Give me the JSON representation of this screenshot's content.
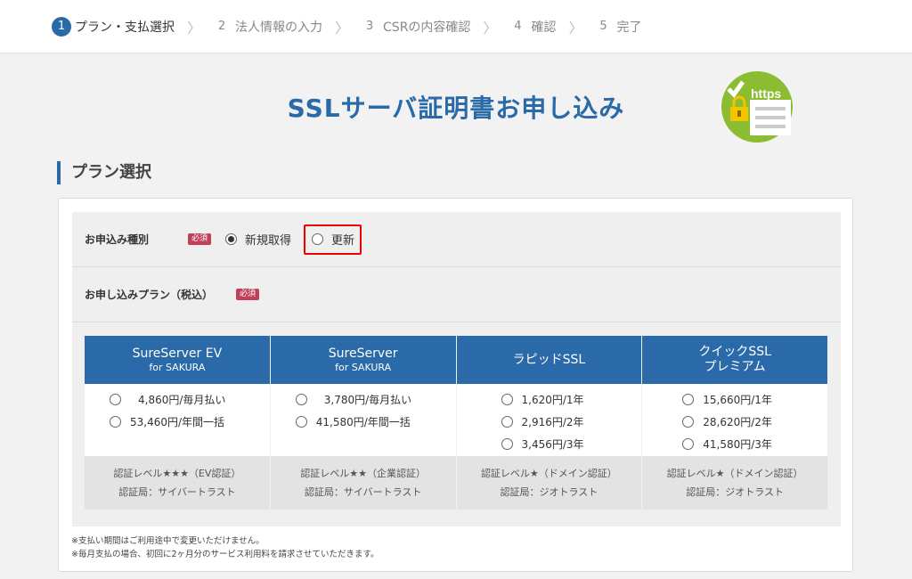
{
  "stepper": {
    "steps": [
      {
        "num": "1",
        "label": "プラン・支払選択"
      },
      {
        "num": "2",
        "label": "法人情報の入力"
      },
      {
        "num": "3",
        "label": "CSRの内容確認"
      },
      {
        "num": "4",
        "label": "確認"
      },
      {
        "num": "5",
        "label": "完了"
      }
    ],
    "active_step": 1
  },
  "page_title": "SSLサーバ証明書お申し込み",
  "badge": {
    "text": "https",
    "icon": "https-lock-icon",
    "color": "#8cbc32"
  },
  "section_title": "プラン選択",
  "form": {
    "required_label": "必須",
    "application_type": {
      "label": "お申込み種別",
      "options": [
        "新規取得",
        "更新"
      ],
      "selected": "新規取得"
    },
    "plan_label": "お申し込みプラン（税込）"
  },
  "plans": [
    {
      "name": "SureServer EV",
      "sub": "for SAKURA",
      "options": [
        "4,860円/毎月払い",
        "53,460円/年間一括"
      ],
      "level": "認証レベル★★★（EV認証）",
      "ca": "認証局：サイバートラスト"
    },
    {
      "name": "SureServer",
      "sub": "for SAKURA",
      "options": [
        "3,780円/毎月払い",
        "41,580円/年間一括"
      ],
      "level": "認証レベル★★（企業認証）",
      "ca": "認証局：サイバートラスト"
    },
    {
      "name": "ラピッドSSL",
      "sub": "",
      "options": [
        "1,620円/1年",
        "2,916円/2年",
        "3,456円/3年"
      ],
      "level": "認証レベル★（ドメイン認証）",
      "ca": "認証局：ジオトラスト"
    },
    {
      "name": "クイックSSL",
      "sub": "プレミアム",
      "options": [
        "15,660円/1年",
        "28,620円/2年",
        "41,580円/3年"
      ],
      "level": "認証レベル★（ドメイン認証）",
      "ca": "認証局：ジオトラスト"
    }
  ],
  "notes": [
    "※支払い期間はご利用途中で変更いただけません。",
    "※毎月支払の場合、初回に2ヶ月分のサービス利用料を請求させていただきます。"
  ],
  "colors": {
    "accent": "#2a6aa8",
    "required": "#c0405a",
    "highlight": "#ee0000"
  }
}
